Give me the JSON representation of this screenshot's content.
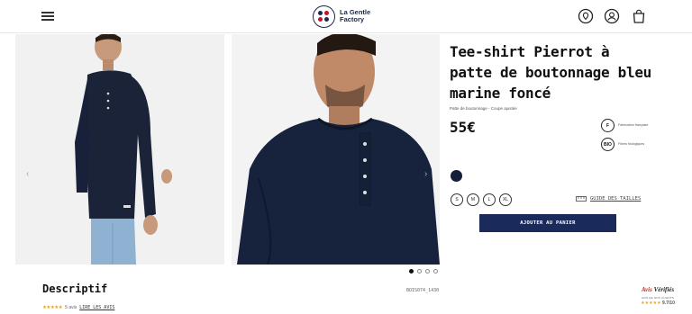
{
  "header": {
    "logo_line1": "La Gentle",
    "logo_line2": "Factory",
    "logo_dot_colors": [
      "#1b2a4a",
      "#c8102e",
      "#c8102e",
      "#1b2a4a"
    ]
  },
  "product": {
    "title": "Tee-shirt Pierrot à patte de boutonnage bleu marine foncé",
    "subtitle": "Patte de boutonnage - Coupe ajustée",
    "price": "55€",
    "badges": [
      {
        "icon": "F",
        "text": "Fabrication française"
      },
      {
        "icon": "BIO",
        "text": "Fibres biologiques"
      }
    ],
    "color": "#14203a",
    "sizes": [
      "S",
      "M",
      "L",
      "XL"
    ],
    "size_guide": "GUIDE DES TAILLES",
    "add_to_cart": "AJOUTER AU PANIER",
    "reference": "BOIS074_1430",
    "gallery": {
      "count": 4,
      "active": 0
    }
  },
  "description": {
    "title": "Descriptif",
    "stars": "★★★★★",
    "reviews_count": "5 avis",
    "read_reviews": "LIRE LES AVIS"
  },
  "verified_reviews": {
    "brand_a": "Avis",
    "brand_b": "Vérifiés",
    "tagline": "AVIS DE NOS CLIENTS",
    "stars": "★★★★★",
    "score": "9.7/10"
  },
  "colors": {
    "accent": "#1a2a5a",
    "text": "#111111"
  }
}
